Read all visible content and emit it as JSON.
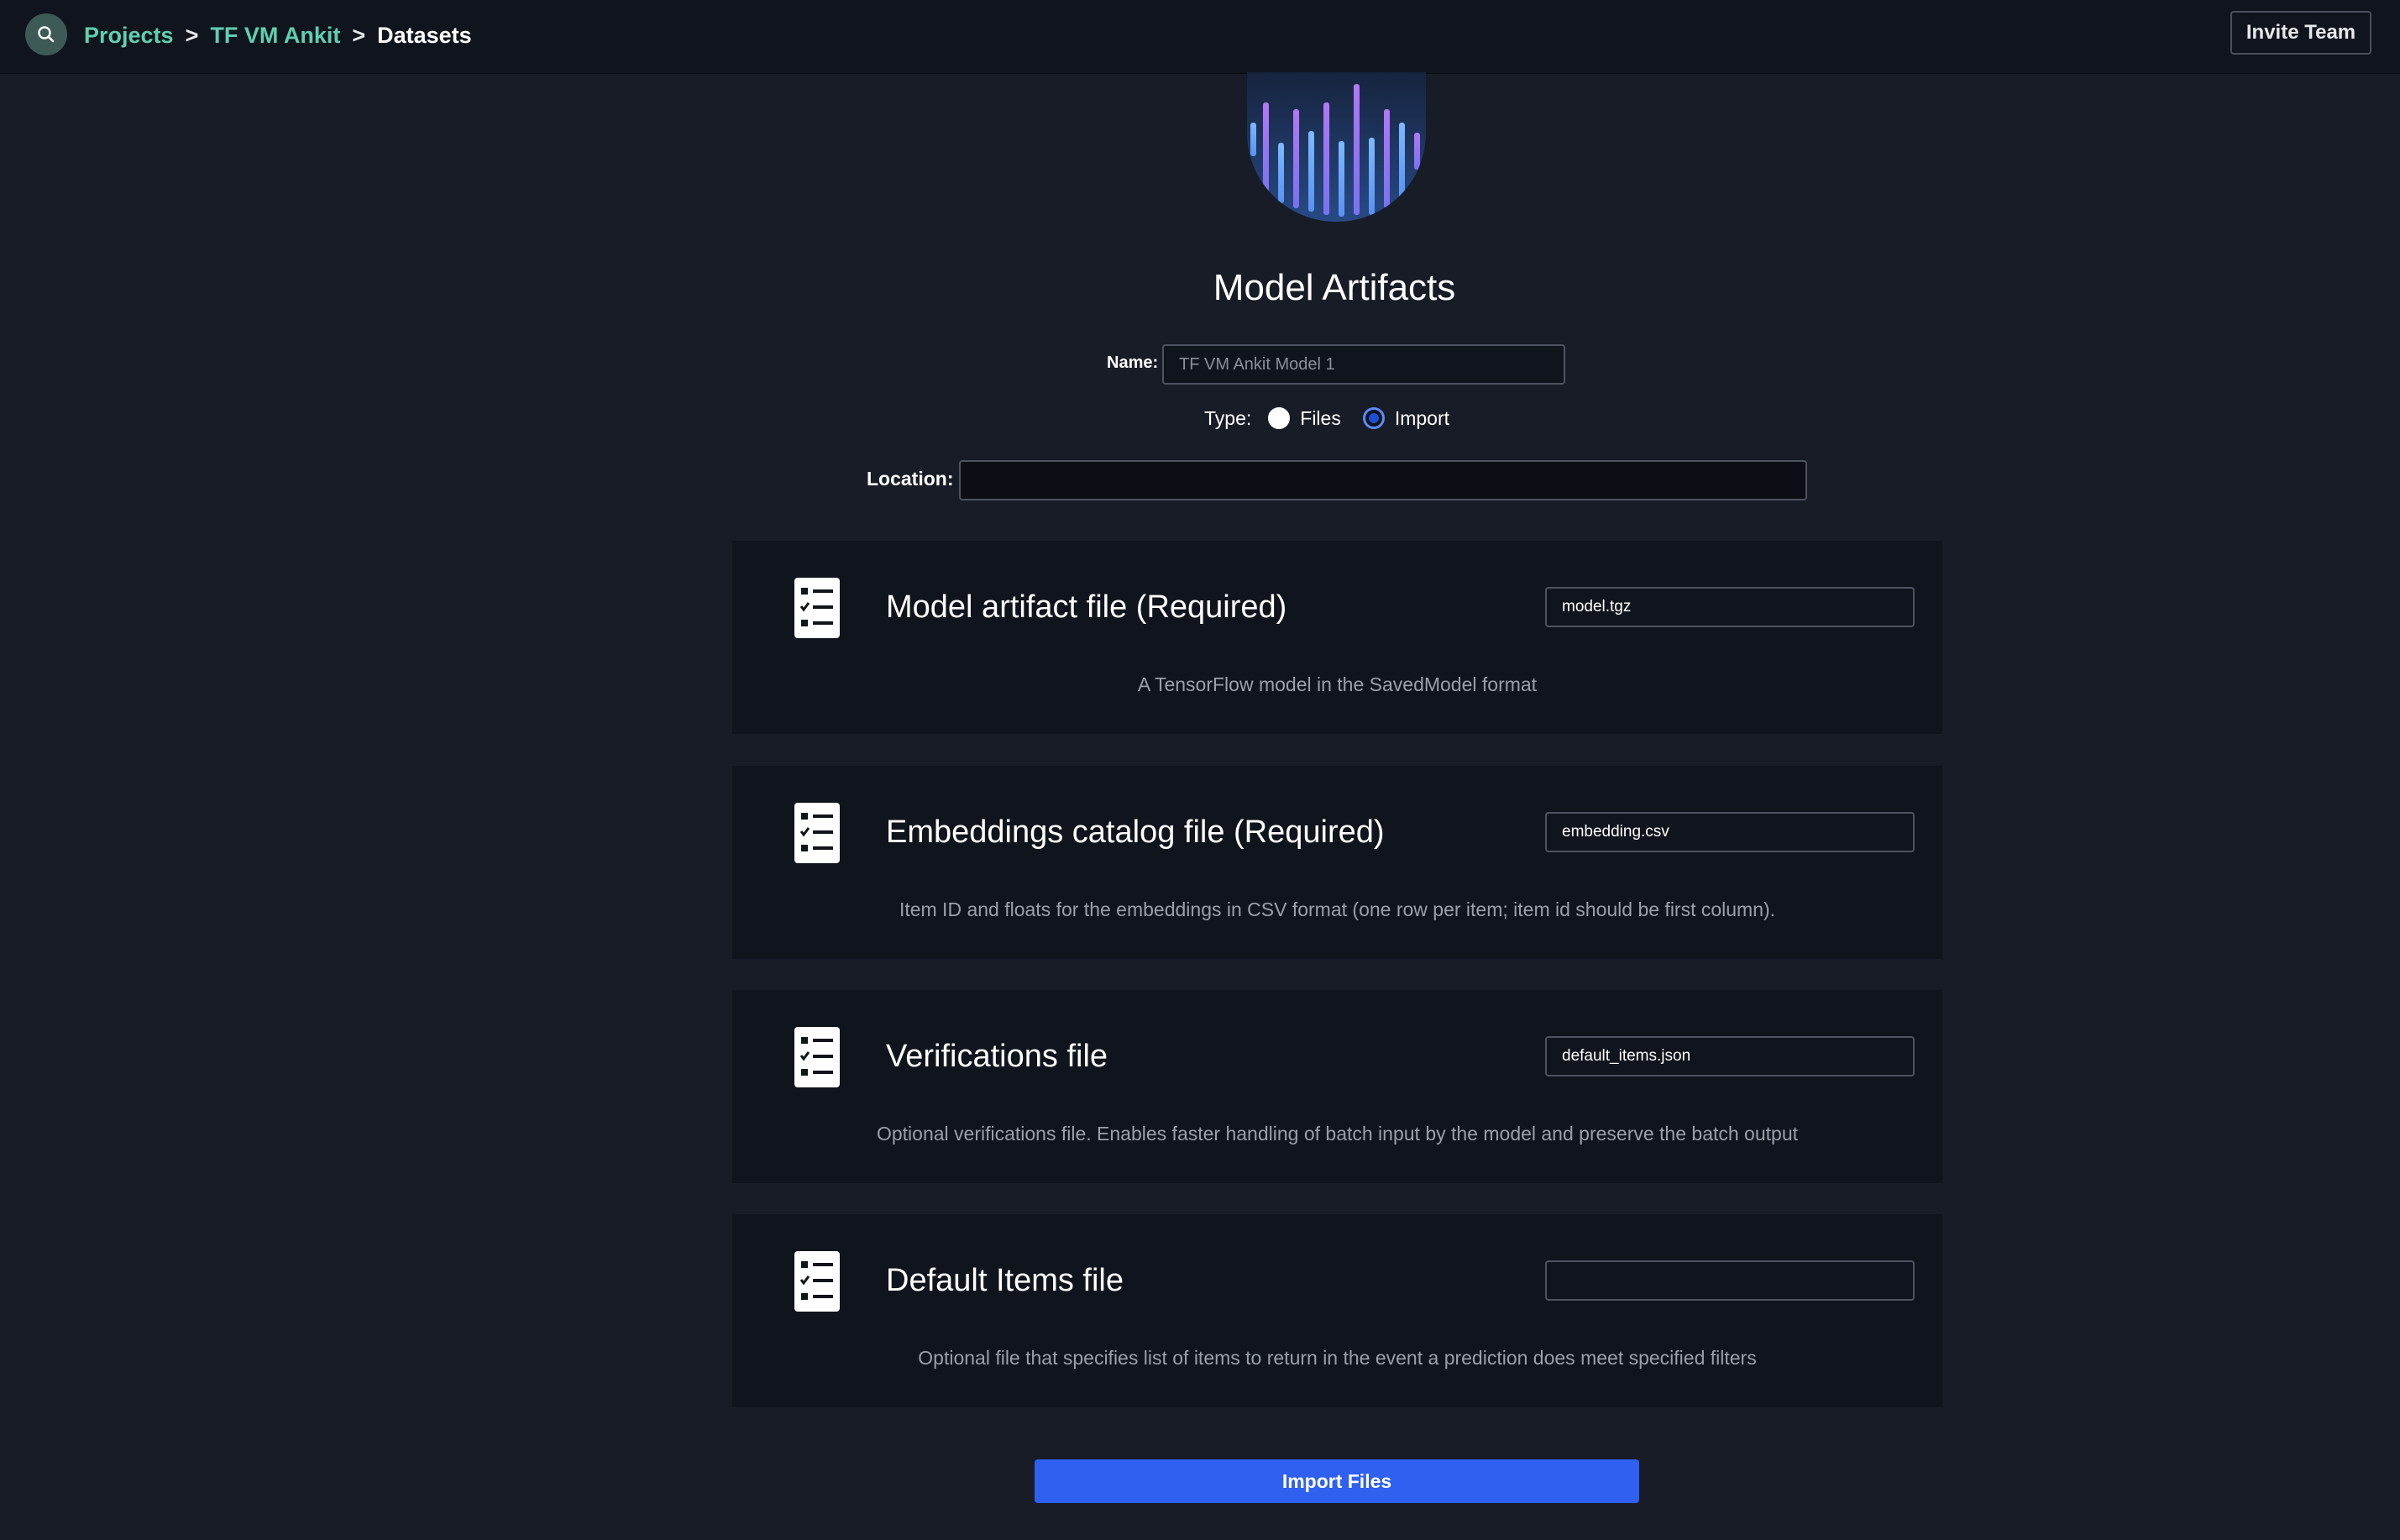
{
  "header": {
    "search_icon": "search-icon",
    "breadcrumb": {
      "projects": "Projects",
      "project_name": "TF VM Ankit",
      "current": "Datasets",
      "separator": ">"
    },
    "invite_label": "Invite Team"
  },
  "page": {
    "title": "Model Artifacts"
  },
  "form": {
    "name_label": "Name:",
    "name_placeholder": "TF VM Ankit Model 1",
    "type_label": "Type:",
    "type_options": [
      "Files",
      "Import"
    ],
    "type_selected": "Import",
    "location_label": "Location:",
    "location_value": ""
  },
  "artifacts": [
    {
      "icon": "checklist-icon",
      "title": "Model artifact file (Required)",
      "value": "model.tgz",
      "description": "A TensorFlow model in the SavedModel format"
    },
    {
      "icon": "checklist-icon",
      "title": "Embeddings catalog file (Required)",
      "value": "embedding.csv",
      "description": "Item ID and floats for the embeddings in CSV format (one row per item; item id should be first column)."
    },
    {
      "icon": "checklist-icon",
      "title": "Verifications file",
      "value": "default_items.json",
      "description": "Optional verifications file. Enables faster handling of batch input by the model and preserve the batch output"
    },
    {
      "icon": "checklist-icon",
      "title": "Default Items file",
      "value": "",
      "description": "Optional file that specifies list of items to return in the event a prediction does meet specified filters"
    }
  ],
  "actions": {
    "import_label": "Import Files"
  },
  "colors": {
    "background": "#181c27",
    "topbar": "#10141d",
    "card": "#10141d",
    "breadcrumb_link": "#5fcfb0",
    "primary_button": "#3060f0"
  }
}
